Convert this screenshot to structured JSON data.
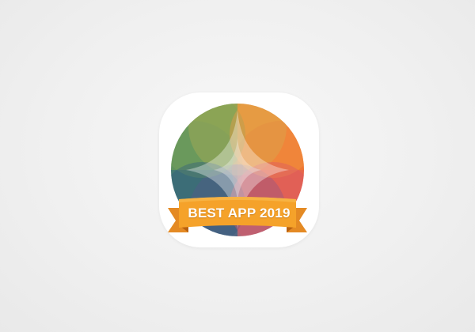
{
  "app_icon": {
    "badge_text": "BEST APP 2019",
    "colors": {
      "green": "#5e8f52",
      "olive": "#a2a64c",
      "orange": "#f08a35",
      "red_orange": "#e96a33",
      "teal": "#3f7f74",
      "navy": "#3d5a80",
      "plum": "#8a5a80",
      "coral": "#e06662",
      "ribbon": "#f5a22a",
      "ribbon_dark": "#d97a1c",
      "ribbon_fold": "#b85f10"
    },
    "icon_name": "color-wheel-icon"
  }
}
